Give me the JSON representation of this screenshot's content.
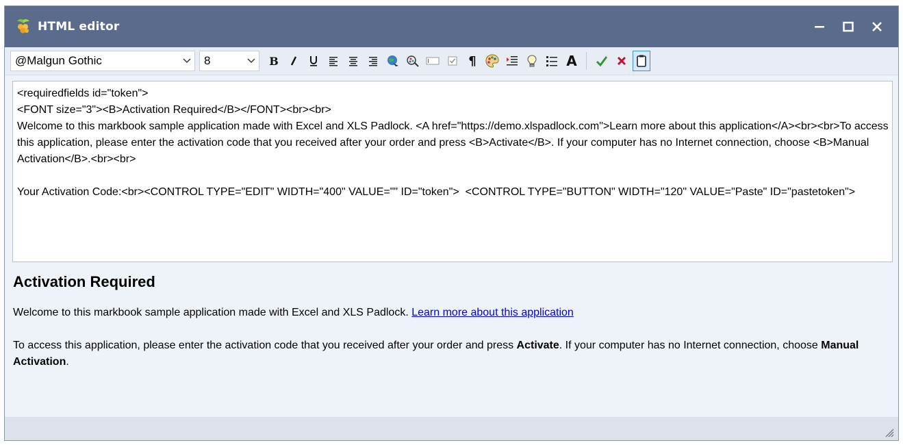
{
  "window": {
    "title": "HTML editor",
    "icon": "grape-app-icon",
    "colors": {
      "titlebar": "#5b6b8b",
      "body": "#eef2f9",
      "link": "#0000ee"
    }
  },
  "toolbar": {
    "font_name": "@Malgun Gothic",
    "font_size": "8",
    "buttons": [
      "bold-icon",
      "italic-icon",
      "underline-icon",
      "align-left-icon",
      "align-center-icon",
      "align-right-icon",
      "insert-link-icon",
      "insert-image-icon",
      "insert-edit-control-icon",
      "insert-checkbox-icon",
      "paragraph-icon",
      "color-palette-icon",
      "indent-icon",
      "tip-bulb-icon",
      "list-icon",
      "font-icon",
      "ok-check-icon",
      "cancel-x-icon",
      "clipboard-icon"
    ]
  },
  "editor": {
    "source": "<requiredfields id=\"token\">\n<FONT size=\"3\"><B>Activation Required</B></FONT><br><br>\nWelcome to this markbook sample application made with Excel and XLS Padlock. <A href=\"https://demo.xlspadlock.com\">Learn more about this application</A><br><br>To access this application, please enter the activation code that you received after your order and press <B>Activate</B>. If your computer has no Internet connection, choose <B>Manual Activation</B>.<br><br>\n\nYour Activation Code:<br><CONTROL TYPE=\"EDIT\" WIDTH=\"400\" VALUE=\"\" ID=\"token\">  <CONTROL TYPE=\"BUTTON\" WIDTH=\"120\" VALUE=\"Paste\" ID=\"pastetoken\">"
  },
  "preview": {
    "heading": "Activation Required",
    "welcome_text": "Welcome to this markbook sample application made with Excel and XLS Padlock. ",
    "link_text": "Learn more about this application",
    "access_text_1": "To access this application, please enter the activation code that you received after your order and press ",
    "activate_bold": "Activate",
    "access_text_2": ". If your computer has no Internet connection, choose ",
    "manual_bold": "Manual Activation",
    "access_text_3": "."
  }
}
